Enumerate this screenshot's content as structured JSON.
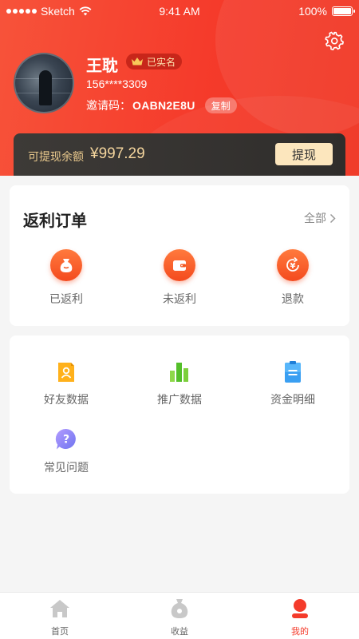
{
  "status_bar": {
    "carrier": "Sketch",
    "time": "9:41 AM",
    "battery": "100%"
  },
  "profile": {
    "name": "王耽",
    "verified_badge": "已实名",
    "phone": "156****3309",
    "invite_label": "邀请码：",
    "invite_code": "OABN2E8U",
    "copy_label": "复制"
  },
  "balance": {
    "label": "可提现余额",
    "amount": "¥997.29",
    "withdraw_label": "提现"
  },
  "orders": {
    "title": "返利订单",
    "all_label": "全部",
    "items": [
      {
        "label": "已返利",
        "icon": "money-bag-icon"
      },
      {
        "label": "未返利",
        "icon": "wallet-icon"
      },
      {
        "label": "退款",
        "icon": "yuan-refund-icon"
      }
    ]
  },
  "tools": {
    "items": [
      {
        "label": "好友数据",
        "icon": "friend-card-icon"
      },
      {
        "label": "推广数据",
        "icon": "bar-chart-icon"
      },
      {
        "label": "资金明细",
        "icon": "clipboard-icon"
      },
      {
        "label": "常见问题",
        "icon": "question-bubble-icon"
      }
    ]
  },
  "tabbar": {
    "tabs": [
      {
        "label": "首页",
        "icon": "home-icon"
      },
      {
        "label": "收益",
        "icon": "money-bag-icon"
      },
      {
        "label": "我的",
        "icon": "person-icon",
        "active": true
      }
    ]
  },
  "colors": {
    "brand_red": "#f43b2b",
    "gold": "#f4d59d",
    "orange": "#ff7a3d"
  }
}
